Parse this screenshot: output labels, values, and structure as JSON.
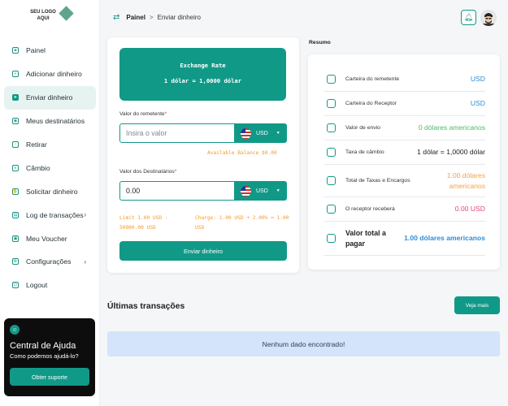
{
  "logo": {
    "text": "SEU LOGO AQUI"
  },
  "sidebar": {
    "items": [
      {
        "label": "Painel",
        "icon": "dashboard-icon"
      },
      {
        "label": "Adicionar dinheiro",
        "icon": "add-money-icon"
      },
      {
        "label": "Enviar dinheiro",
        "icon": "send-money-icon",
        "active": true
      },
      {
        "label": "Meus destinatários",
        "icon": "recipients-icon"
      },
      {
        "label": "Retirar",
        "icon": "withdraw-icon"
      },
      {
        "label": "Câmbio",
        "icon": "exchange-icon"
      },
      {
        "label": "Solicitar dinheiro",
        "icon": "request-money-icon"
      },
      {
        "label": "Log de transações",
        "icon": "transactions-log-icon",
        "chevron": "›"
      },
      {
        "label": "Meu Voucher",
        "icon": "voucher-icon"
      },
      {
        "label": "Configurações",
        "icon": "settings-icon",
        "chevron": "›"
      },
      {
        "label": "Logout",
        "icon": "logout-icon"
      }
    ]
  },
  "help": {
    "title": "Central de Ajuda",
    "subtitle": "Como podemos ajudá-lo?",
    "button": "Obter suporte"
  },
  "breadcrumb": {
    "root": "Painel",
    "separator": ">",
    "current": "Enviar dinheiro"
  },
  "rate": {
    "title": "Exchange Rate",
    "value": "1 dólar = 1,0000 dólar"
  },
  "sender": {
    "label": "Valor do remetente",
    "required": "*",
    "placeholder": "Insira o valor",
    "currency": "USD",
    "balance": "Available Balance $0.00"
  },
  "recipient": {
    "label": "Valor dos Destinatários",
    "required": "*",
    "value": "0.00",
    "currency": "USD"
  },
  "limits": {
    "limit": "Limit 1.00 USD - 50000.00 USD",
    "charge": "Charge: 1.00 USD + 2.00% = 1.00 USD"
  },
  "send_button": "Enviar dinheiro",
  "summary": {
    "title": "Resumo",
    "rows": [
      {
        "label": "Carteira do remetente",
        "value": "USD",
        "color": "#2d8ed6"
      },
      {
        "label": "Carteira do Receptor",
        "value": "USD",
        "color": "#2d8ed6"
      },
      {
        "label": "Valor de envio",
        "value": "0 dólares americanos",
        "color": "#4cba5d"
      },
      {
        "label": "Taxa de câmbio",
        "value": "1 dólar = 1,0000 dólar",
        "color": "#222222"
      },
      {
        "label": "Total de Taxas e Encargos",
        "value": "1.00 dólares americanos",
        "color": "#f1a340"
      },
      {
        "label": "O receptor receberá",
        "value": "0.00 USD",
        "color": "#e5477a"
      },
      {
        "label": "Valor total a pagar",
        "value": "1.00 dólares americanos",
        "color": "#2d8ed6"
      }
    ]
  },
  "transactions": {
    "title": "Últimas transações",
    "more_button": "Veja mais",
    "empty": "Nenhum dado encontrado!"
  },
  "colors": {
    "accent": "#119987"
  }
}
